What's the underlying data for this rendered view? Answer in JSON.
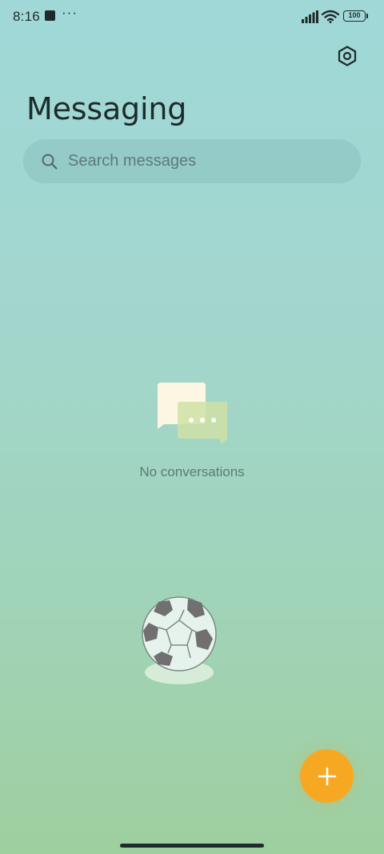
{
  "status_bar": {
    "time": "8:16",
    "more_indicator": "···",
    "battery_level": "100"
  },
  "header": {
    "title": "Messaging",
    "settings_icon": "gear-icon"
  },
  "search": {
    "placeholder": "Search messages",
    "icon": "search-icon"
  },
  "empty_state": {
    "icon": "chat-bubbles-icon",
    "text": "No conversations"
  },
  "fab": {
    "icon": "plus-icon",
    "color": "#f7a823"
  },
  "colors": {
    "background_top": "#a0d8d8",
    "background_bottom": "#9ecf9f",
    "accent": "#f7a823"
  }
}
